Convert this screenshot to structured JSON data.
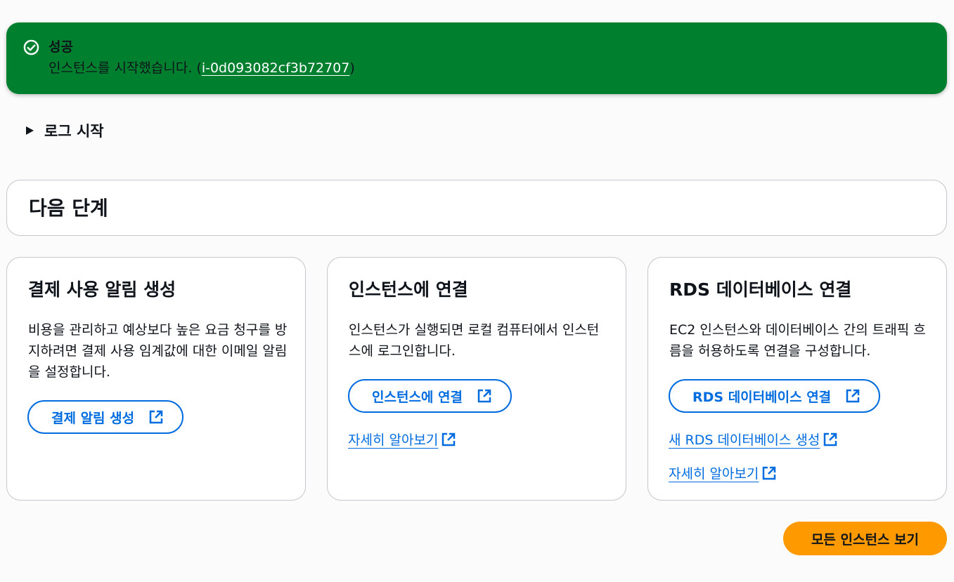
{
  "flash": {
    "title": "성공",
    "message_prefix": "인스턴스를 시작했습니다. (",
    "instance_id": "i-0d093082cf3b72707",
    "message_suffix": ")"
  },
  "log": {
    "label": "로그 시작"
  },
  "next_steps": {
    "title": "다음 단계",
    "cards": [
      {
        "title": "결제 사용 알림 생성",
        "description": "비용을 관리하고 예상보다 높은 요금 청구를 방지하려면 결제 사용 임계값에 대한 이메일 알림을 설정합니다.",
        "button_label": "결제 알림 생성"
      },
      {
        "title": "인스턴스에 연결",
        "description": "인스턴스가 실행되면 로컬 컴퓨터에서 인스턴스에 로그인합니다.",
        "button_label": "인스턴스에 연결",
        "link_learn_more": "자세히 알아보기"
      },
      {
        "title": "RDS 데이터베이스 연결",
        "description": "EC2 인스턴스와 데이터베이스 간의 트래픽 흐름을 허용하도록 연결을 구성합니다.",
        "button_label": "RDS 데이터베이스 연결",
        "link_create": "새 RDS 데이터베이스 생성",
        "link_learn_more": "자세히 알아보기"
      }
    ]
  },
  "footer": {
    "view_all_label": "모든 인스턴스 보기"
  },
  "colors": {
    "success": "#00802f",
    "link": "#006ce0",
    "primary": "#ff9900"
  },
  "icons": {
    "success": "check-circle-icon",
    "external": "external-link-icon",
    "expand": "caret-right-icon"
  }
}
